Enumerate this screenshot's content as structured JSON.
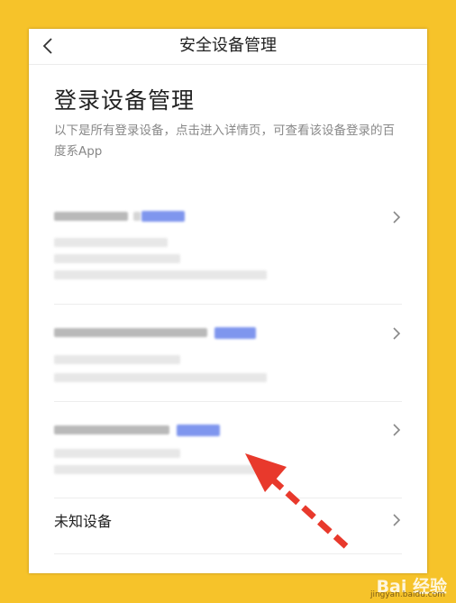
{
  "navbar": {
    "title": "安全设备管理",
    "back_icon": "chevron-left-icon"
  },
  "main": {
    "heading": "登录设备管理",
    "description": "以下是所有登录设备，点击进入详情页，可查看该设备登录的百度系App",
    "unknown_device_label": "未知设备",
    "chevron_icon": "chevron-right-icon"
  },
  "overlay": {
    "arrow_color": "#e8392c",
    "watermark_main": "Bai 经验",
    "watermark_sub": "jingyan.baidu.com"
  },
  "colors": {
    "background": "#f6c32a",
    "redacted_highlight": "#7f96ee"
  }
}
